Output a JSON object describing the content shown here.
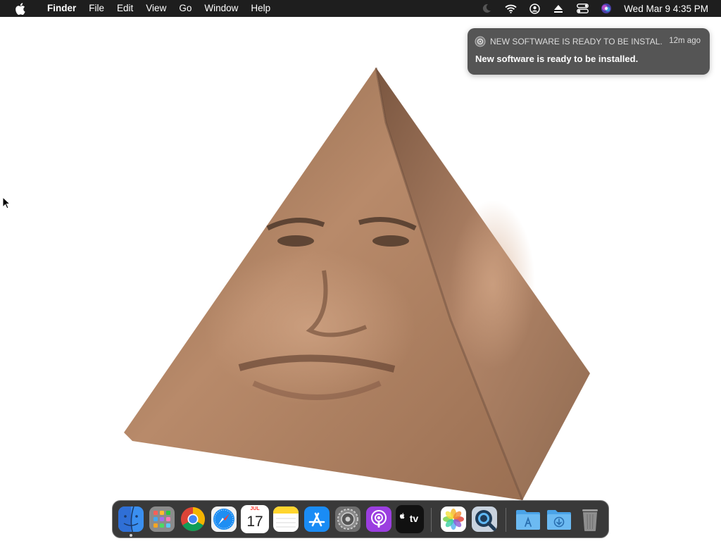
{
  "menubar": {
    "app_name": "Finder",
    "menus": [
      "File",
      "Edit",
      "View",
      "Go",
      "Window",
      "Help"
    ],
    "clock": "Wed Mar 9  4:35 PM"
  },
  "notification": {
    "title": "NEW SOFTWARE IS READY TO BE INSTAL...",
    "time": "12m ago",
    "body": "New software is ready to be installed."
  },
  "dock": {
    "calendar_month": "JUL",
    "calendar_day": "17",
    "tv_label": "tv"
  },
  "colors": {
    "menubar_bg": "#1e1e1e",
    "notification_bg": "#555555",
    "dock_bg": "#282828"
  }
}
